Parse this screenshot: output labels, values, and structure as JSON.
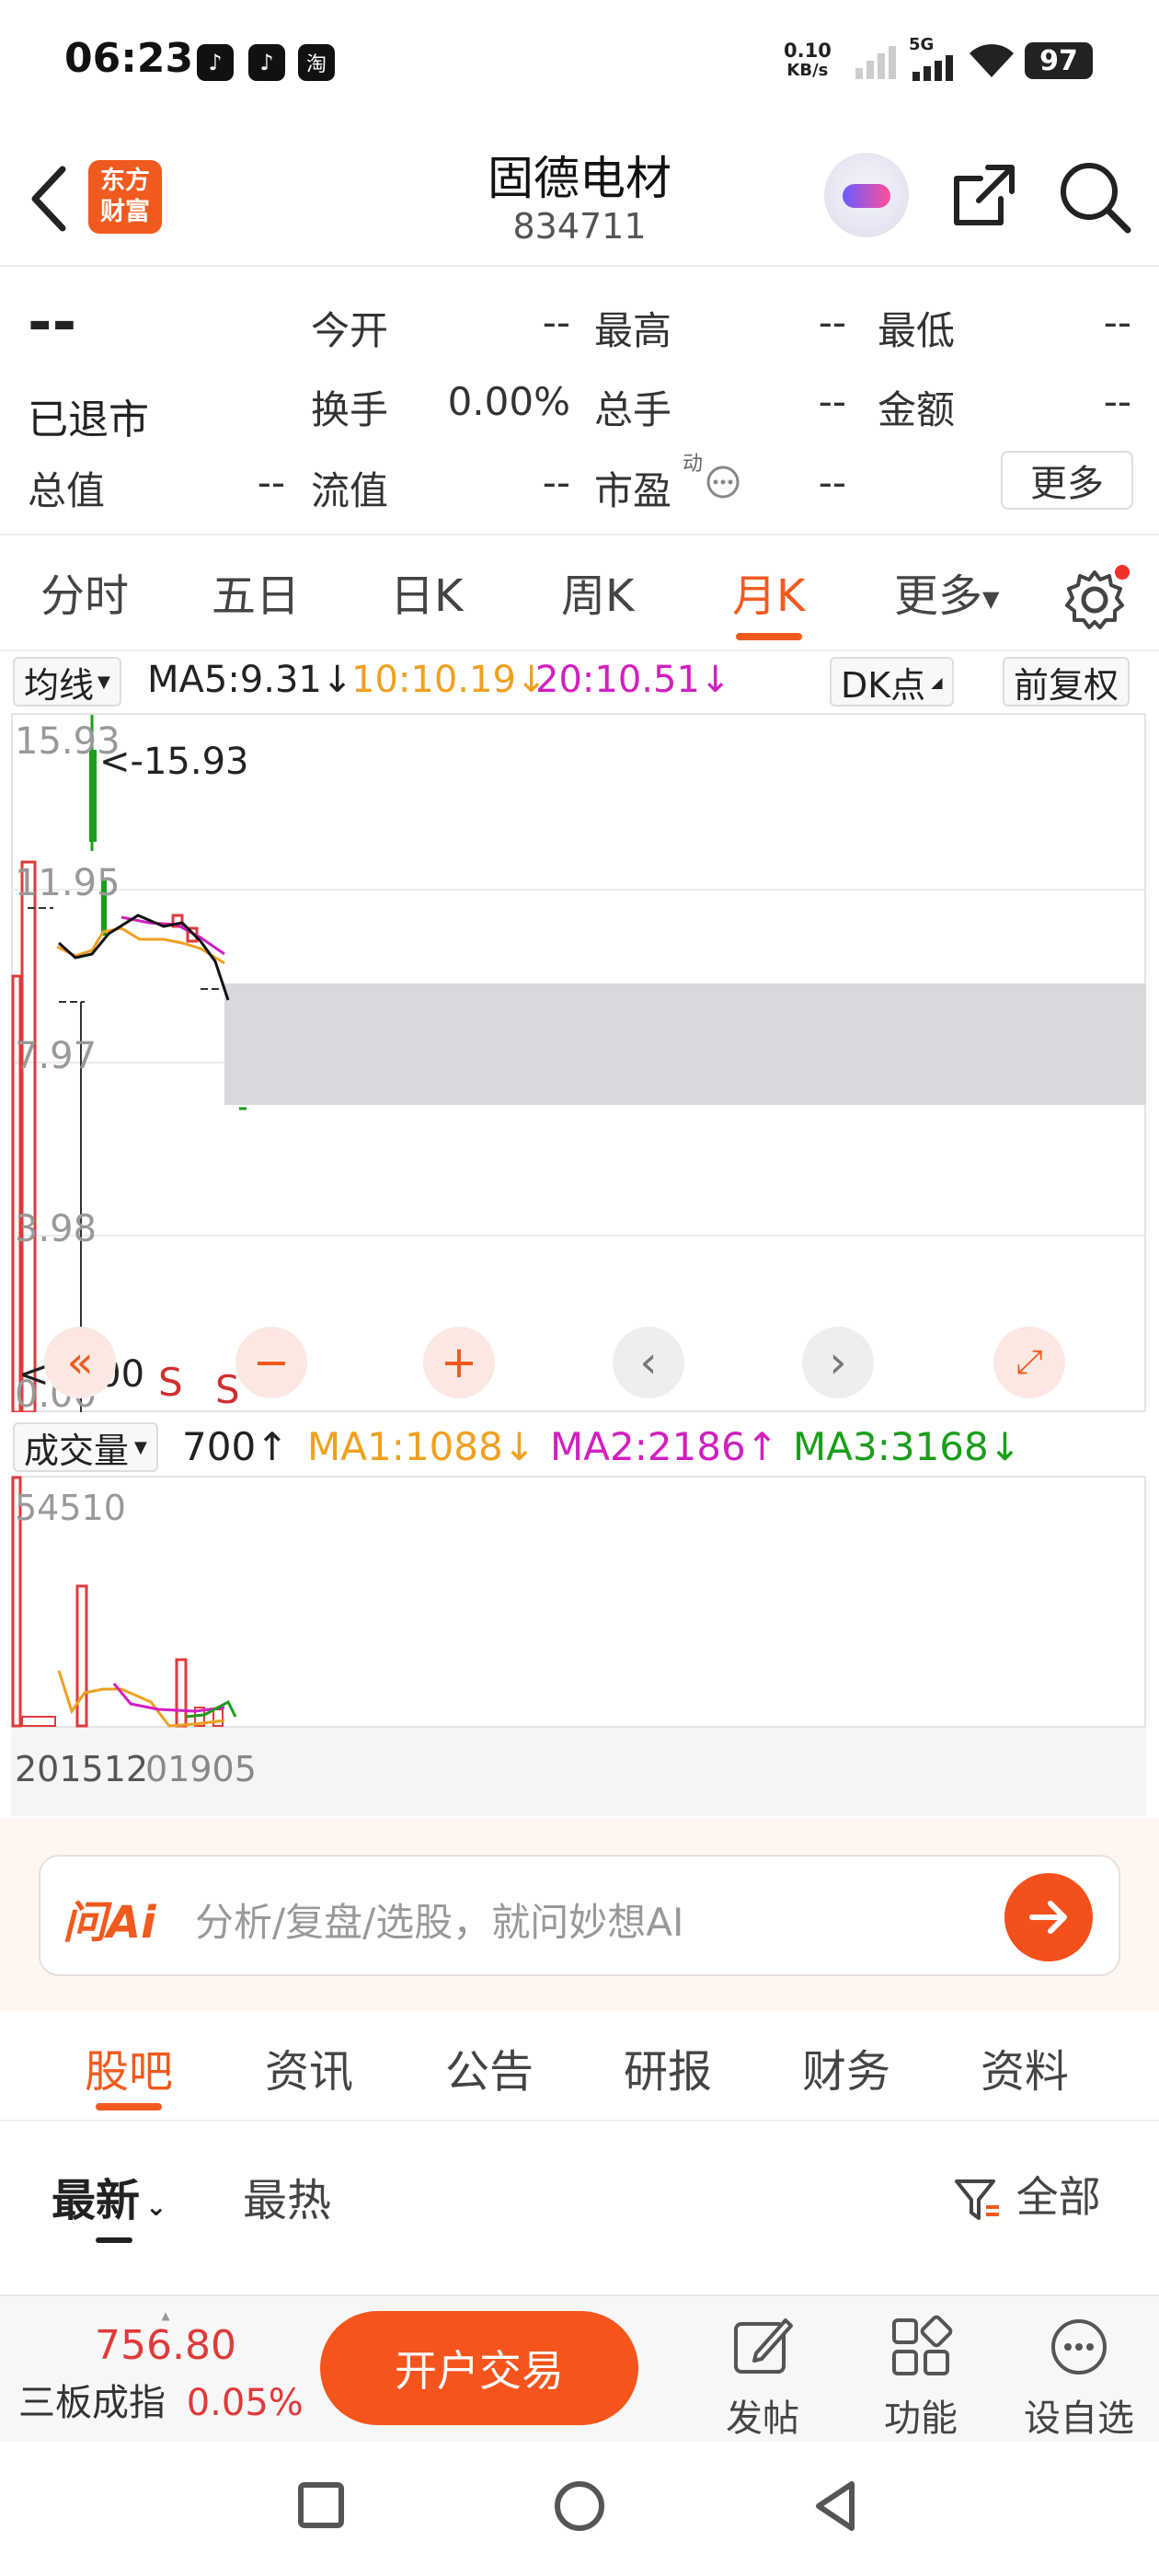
{
  "status_bar": {
    "time": "06:23",
    "app_icons": [
      "douyin-icon",
      "douyin-icon",
      "taobao-icon"
    ],
    "net_speed_value": "0.10",
    "net_speed_unit": "KB/s",
    "network": "5G",
    "battery": "97"
  },
  "header": {
    "logo_line1": "东方",
    "logo_line2": "财富",
    "title": "固德电材",
    "code": "834711"
  },
  "quote": {
    "price": "--",
    "status": "已退市",
    "fields": [
      {
        "label": "今开",
        "value": "--"
      },
      {
        "label": "最高",
        "value": "--"
      },
      {
        "label": "最低",
        "value": "--"
      },
      {
        "label": "换手",
        "value": "0.00%"
      },
      {
        "label": "总手",
        "value": "--"
      },
      {
        "label": "金额",
        "value": "--"
      },
      {
        "label": "总值",
        "value": "--"
      },
      {
        "label": "流值",
        "value": "--"
      },
      {
        "label": "市盈",
        "value": "--"
      }
    ],
    "pe_superscript": "动",
    "more_label": "更多"
  },
  "period_tabs": {
    "items": [
      "分时",
      "五日",
      "日K",
      "周K",
      "月K",
      "更多"
    ],
    "active": "月K"
  },
  "ma_line": {
    "selector_label": "均线",
    "ma5": "MA5:9.31",
    "ma10": "10:10.19",
    "ma20": "20:10.51",
    "dk_label": "DK点",
    "fq_label": "前复权",
    "colors": {
      "ma5": "#222222",
      "ma10": "#f0a020",
      "ma20": "#d020c0"
    }
  },
  "chart": {
    "y_labels": [
      "15.93",
      "11.95",
      "7.97",
      "3.98",
      "0.00"
    ],
    "max_label": "<-15.93",
    "min_label": "<-0.00",
    "s_marker": "S"
  },
  "volume": {
    "selector_label": "成交量",
    "value": "700",
    "ma1": "MA1:1088",
    "ma2": "MA2:2186",
    "ma3": "MA3:3168",
    "max_label": "54510",
    "date_start": "201512",
    "date_end": "01905",
    "colors": {
      "ma1": "#f0a020",
      "ma2": "#d020c0",
      "ma3": "#1a9e1a"
    }
  },
  "ai": {
    "brand": "问Ai",
    "placeholder": "分析/复盘/选股，就问妙想AI"
  },
  "sub_tabs": {
    "items": [
      "股吧",
      "资讯",
      "公告",
      "研报",
      "财务",
      "资料"
    ],
    "active": "股吧"
  },
  "sort": {
    "latest": "最新",
    "hot": "最热",
    "filter": "全部"
  },
  "bottom_bar": {
    "index_value": "756.80",
    "index_name": "三板成指",
    "index_change": "0.05%",
    "trade_label": "开户交易",
    "post_label": "发帖",
    "function_label": "功能",
    "watch_label": "设自选"
  }
}
